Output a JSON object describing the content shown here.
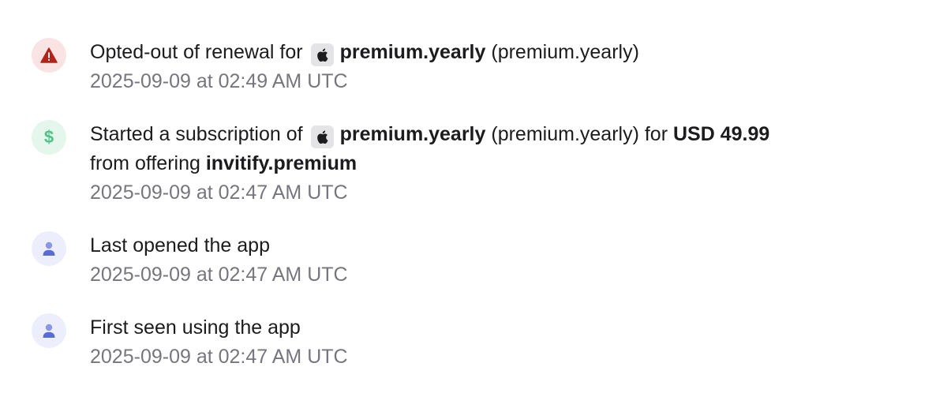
{
  "events": [
    {
      "icon": "warning-icon",
      "prefix": "Opted-out of renewal for",
      "store_icon": "apple-icon",
      "product": "premium.yearly",
      "product_id": "(premium.yearly)",
      "timestamp": "2025-09-09 at 02:49 AM UTC"
    },
    {
      "icon": "dollar-icon",
      "dollar_symbol": "$",
      "prefix": "Started a subscription of",
      "store_icon": "apple-icon",
      "product": "premium.yearly",
      "product_id": "(premium.yearly)",
      "for_text": "for",
      "price": "USD 49.99",
      "offering_prefix": "from offering",
      "offering": "invitify.premium",
      "timestamp": "2025-09-09 at 02:47 AM UTC"
    },
    {
      "icon": "user-icon",
      "text": "Last opened the app",
      "timestamp": "2025-09-09 at 02:47 AM UTC"
    },
    {
      "icon": "user-icon",
      "text": "First seen using the app",
      "timestamp": "2025-09-09 at 02:47 AM UTC"
    }
  ],
  "colors": {
    "warning_bg": "#f9e3e3",
    "warning_fg": "#b42318",
    "money_bg": "#e5f6ec",
    "money_fg": "#4cc487",
    "user_bg": "#eceefb",
    "user_fg": "#5b6ad9",
    "muted_text": "#76767e"
  }
}
